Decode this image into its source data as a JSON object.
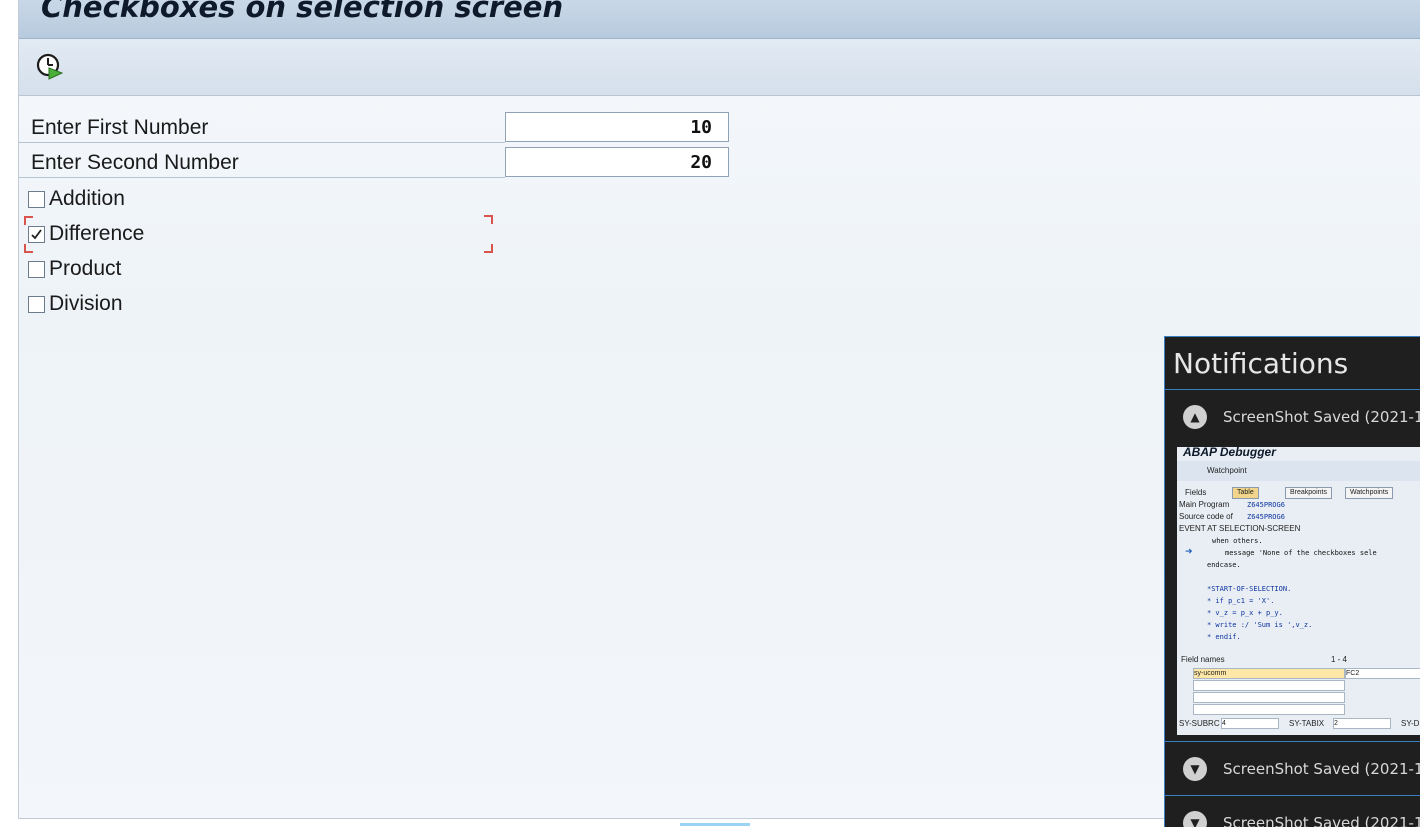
{
  "window": {
    "title": "Checkboxes on selection screen"
  },
  "toolbar": {
    "execute_icon": "execute-clock-icon"
  },
  "form": {
    "first_label": "Enter First Number",
    "first_value": "10",
    "second_label": "Enter Second Number",
    "second_value": "20",
    "checkboxes": [
      {
        "label": "Addition",
        "checked": false
      },
      {
        "label": "Difference",
        "checked": true
      },
      {
        "label": "Product",
        "checked": false
      },
      {
        "label": "Division",
        "checked": false
      }
    ]
  },
  "notifications": {
    "title": "Notifications",
    "items": [
      {
        "text": "ScreenShot Saved  (2021-12-2",
        "expanded": true
      },
      {
        "text": "ScreenShot Saved  (2021-12-2",
        "expanded": false
      },
      {
        "text": "ScreenShot Saved  (2021-12-2",
        "expanded": false
      }
    ],
    "thumbnail": {
      "title": "ABAP Debugger",
      "watchpoint": "Watchpoint",
      "fields_label": "Fields",
      "tabs": [
        "Table",
        "Breakpoints",
        "Watchpoints"
      ],
      "main_program_label": "Main Program",
      "main_program_value": "Z645PROG6",
      "source_code_label": "Source code of",
      "source_code_value": "Z645PROG6",
      "event": "EVENT AT SELECTION-SCREEN",
      "code_lines": [
        "when others.",
        "message 'None of the checkboxes sele",
        "endcase.",
        "",
        "*START-OF-SELECTION.",
        "*  if p_c1 = 'X'.",
        "*    v_z = p_x + p_y.",
        "*    write :/ 'Sum is ',v_z.",
        "*  endif."
      ],
      "field_names_label": "Field names",
      "range": "1 - 4",
      "field_name_1": "sy-ucomm",
      "field_value_1": "FC2",
      "subrc_label": "SY-SUBRC",
      "subrc_value": "4",
      "tabix_label": "SY-TABIX",
      "tabix_value": "2",
      "sy_d_label": "SY-D"
    }
  }
}
